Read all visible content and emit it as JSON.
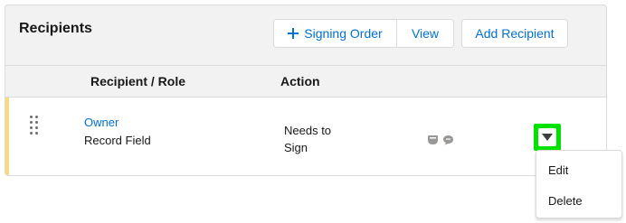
{
  "card": {
    "title": "Recipients",
    "buttons": {
      "signing_order": "Signing Order",
      "view": "View",
      "add_recipient": "Add Recipient"
    }
  },
  "table": {
    "columns": {
      "recipient_role": "Recipient / Role",
      "action": "Action"
    },
    "rows": [
      {
        "name": "Owner",
        "role": "Record Field",
        "action": "Needs to Sign",
        "status_icons": [
          "id-card-icon",
          "chat-icon"
        ]
      }
    ]
  },
  "row_menu": {
    "items": [
      "Edit",
      "Delete"
    ]
  },
  "colors": {
    "link": "#0070d2",
    "row_accent": "#f8d97b",
    "highlight": "#00e300",
    "border": "#dddbda",
    "header_bg": "#f3f2f2"
  }
}
